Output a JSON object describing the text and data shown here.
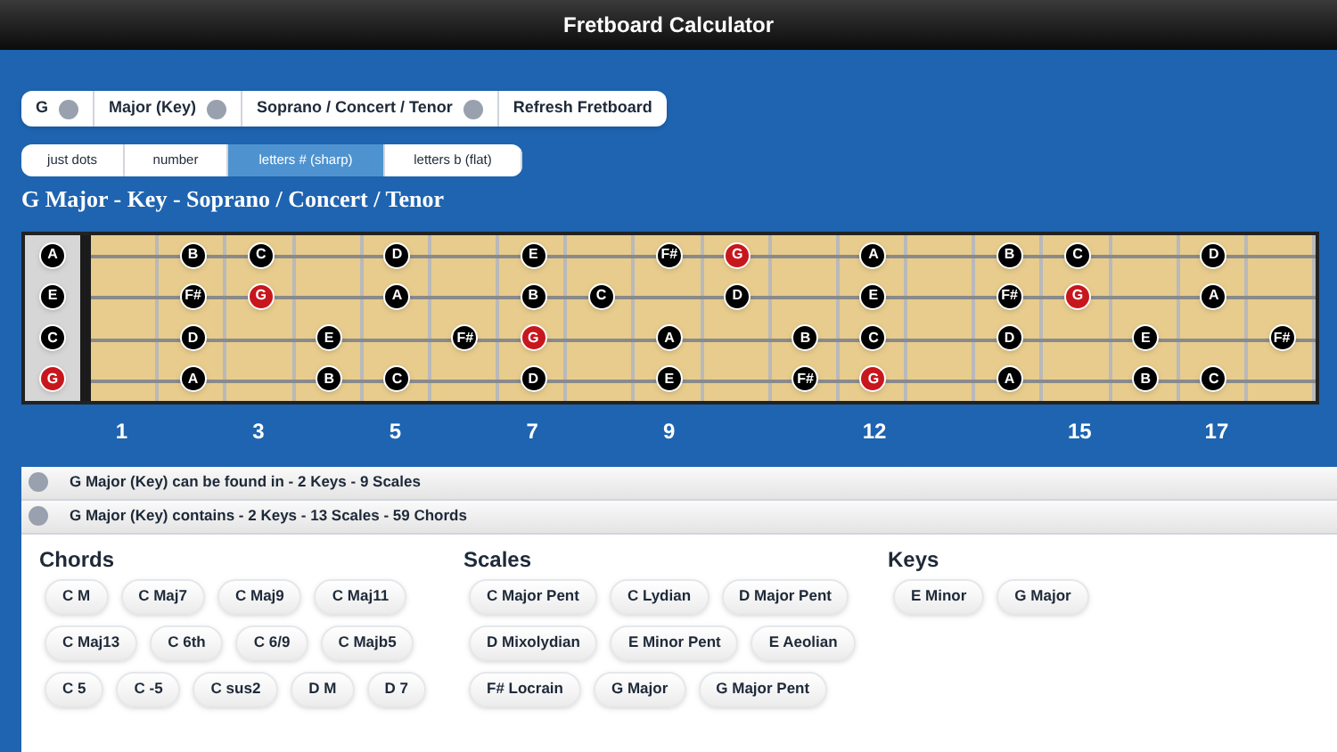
{
  "window": {
    "title": "Fretboard Calculator"
  },
  "selectors": [
    {
      "label": "G",
      "kind": "dot"
    },
    {
      "label": "Major (Key)",
      "kind": "dot"
    },
    {
      "label": "Soprano / Concert / Tenor",
      "kind": "dot"
    },
    {
      "label": "Refresh Fretboard",
      "kind": "plain"
    }
  ],
  "view_tabs": [
    {
      "label": "just dots",
      "selected": false
    },
    {
      "label": "number",
      "selected": false
    },
    {
      "label": "letters # (sharp)",
      "selected": true
    },
    {
      "label": "letters b (flat)",
      "selected": false
    }
  ],
  "heading": "G Major - Key - Soprano / Concert / Tenor",
  "fretboard": {
    "strings": [
      {
        "open": {
          "note": "A",
          "root": false
        },
        "frets": [
          {
            "kind": "empty"
          },
          {
            "kind": "note",
            "note": "B",
            "root": false
          },
          {
            "kind": "note",
            "note": "C",
            "root": false
          },
          {
            "kind": "empty"
          },
          {
            "kind": "note",
            "note": "D",
            "root": false
          },
          {
            "kind": "empty"
          },
          {
            "kind": "note",
            "note": "E",
            "root": false
          },
          {
            "kind": "empty"
          },
          {
            "kind": "note",
            "note": "F#",
            "root": false
          },
          {
            "kind": "note",
            "note": "G",
            "root": true
          },
          {
            "kind": "empty"
          },
          {
            "kind": "note",
            "note": "A",
            "root": false
          },
          {
            "kind": "empty"
          },
          {
            "kind": "note",
            "note": "B",
            "root": false
          },
          {
            "kind": "note",
            "note": "C",
            "root": false
          },
          {
            "kind": "empty"
          },
          {
            "kind": "note",
            "note": "D",
            "root": false
          },
          {
            "kind": "empty"
          }
        ]
      },
      {
        "open": {
          "note": "E",
          "root": false
        },
        "frets": [
          {
            "kind": "empty"
          },
          {
            "kind": "note",
            "note": "F#",
            "root": false
          },
          {
            "kind": "note",
            "note": "G",
            "root": true
          },
          {
            "kind": "empty"
          },
          {
            "kind": "note",
            "note": "A",
            "root": false
          },
          {
            "kind": "empty"
          },
          {
            "kind": "note",
            "note": "B",
            "root": false
          },
          {
            "kind": "note",
            "note": "C",
            "root": false
          },
          {
            "kind": "empty"
          },
          {
            "kind": "note",
            "note": "D",
            "root": false
          },
          {
            "kind": "empty"
          },
          {
            "kind": "note",
            "note": "E",
            "root": false
          },
          {
            "kind": "empty"
          },
          {
            "kind": "note",
            "note": "F#",
            "root": false
          },
          {
            "kind": "note",
            "note": "G",
            "root": true
          },
          {
            "kind": "empty"
          },
          {
            "kind": "note",
            "note": "A",
            "root": false
          },
          {
            "kind": "empty"
          }
        ]
      },
      {
        "open": {
          "note": "C",
          "root": false
        },
        "frets": [
          {
            "kind": "empty"
          },
          {
            "kind": "note",
            "note": "D",
            "root": false
          },
          {
            "kind": "empty"
          },
          {
            "kind": "note",
            "note": "E",
            "root": false
          },
          {
            "kind": "empty"
          },
          {
            "kind": "note",
            "note": "F#",
            "root": false
          },
          {
            "kind": "note",
            "note": "G",
            "root": true
          },
          {
            "kind": "empty"
          },
          {
            "kind": "note",
            "note": "A",
            "root": false
          },
          {
            "kind": "empty"
          },
          {
            "kind": "note",
            "note": "B",
            "root": false
          },
          {
            "kind": "note",
            "note": "C",
            "root": false
          },
          {
            "kind": "empty"
          },
          {
            "kind": "note",
            "note": "D",
            "root": false
          },
          {
            "kind": "empty"
          },
          {
            "kind": "note",
            "note": "E",
            "root": false
          },
          {
            "kind": "empty"
          },
          {
            "kind": "note",
            "note": "F#",
            "root": false
          }
        ]
      },
      {
        "open": {
          "note": "G",
          "root": true
        },
        "frets": [
          {
            "kind": "empty"
          },
          {
            "kind": "note",
            "note": "A",
            "root": false
          },
          {
            "kind": "empty"
          },
          {
            "kind": "note",
            "note": "B",
            "root": false
          },
          {
            "kind": "note",
            "note": "C",
            "root": false
          },
          {
            "kind": "empty"
          },
          {
            "kind": "note",
            "note": "D",
            "root": false
          },
          {
            "kind": "empty"
          },
          {
            "kind": "note",
            "note": "E",
            "root": false
          },
          {
            "kind": "empty"
          },
          {
            "kind": "note",
            "note": "F#",
            "root": false
          },
          {
            "kind": "note",
            "note": "G",
            "root": true
          },
          {
            "kind": "empty"
          },
          {
            "kind": "note",
            "note": "A",
            "root": false
          },
          {
            "kind": "empty"
          },
          {
            "kind": "note",
            "note": "B",
            "root": false
          },
          {
            "kind": "note",
            "note": "C",
            "root": false
          },
          {
            "kind": "empty"
          }
        ]
      }
    ],
    "fret_numbers": [
      {
        "kind": "label",
        "label": "1"
      },
      {
        "kind": "blank"
      },
      {
        "kind": "label",
        "label": "3"
      },
      {
        "kind": "blank"
      },
      {
        "kind": "label",
        "label": "5"
      },
      {
        "kind": "blank"
      },
      {
        "kind": "label",
        "label": "7"
      },
      {
        "kind": "blank"
      },
      {
        "kind": "label",
        "label": "9"
      },
      {
        "kind": "blank"
      },
      {
        "kind": "blank"
      },
      {
        "kind": "label",
        "label": "12"
      },
      {
        "kind": "blank"
      },
      {
        "kind": "blank"
      },
      {
        "kind": "label",
        "label": "15"
      },
      {
        "kind": "blank"
      },
      {
        "kind": "label",
        "label": "17"
      },
      {
        "kind": "blank"
      }
    ]
  },
  "info_rows": [
    {
      "label": "G Major (Key) can be found in - 2 Keys - 9 Scales"
    },
    {
      "label": "G Major (Key) contains - 2 Keys - 13 Scales - 59 Chords"
    }
  ],
  "groups": [
    {
      "title": "Chords",
      "items": [
        "C M",
        "C Maj7",
        "C Maj9",
        "C Maj11",
        "C Maj13",
        "C 6th",
        "C 6/9",
        "C Majb5",
        "C 5",
        "C -5",
        "C sus2",
        "D M",
        "D 7"
      ]
    },
    {
      "title": "Scales",
      "items": [
        "C Major Pent",
        "C Lydian",
        "D Major Pent",
        "D Mixolydian",
        "E Minor Pent",
        "E Aeolian",
        "F# Locrain",
        "G Major",
        "G Major Pent"
      ]
    },
    {
      "title": "Keys",
      "items": [
        "E Minor",
        "G Major"
      ]
    }
  ]
}
